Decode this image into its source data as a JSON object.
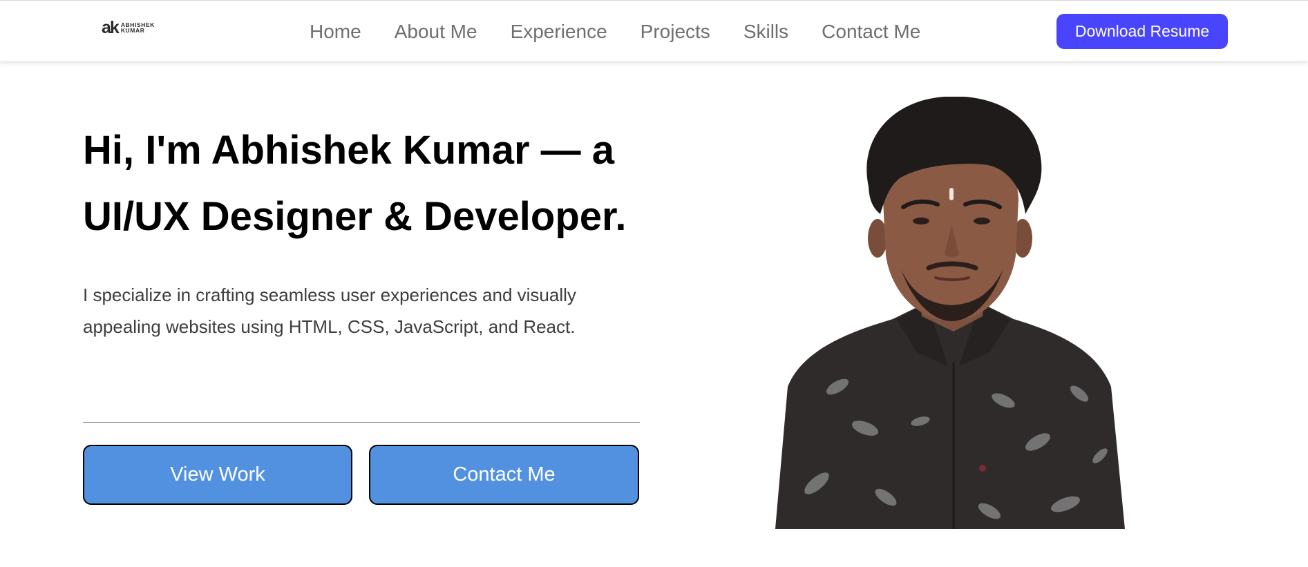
{
  "nav": {
    "logo": {
      "mark": "ak",
      "line1": "ABHISHEK",
      "line2": "KUMAR"
    },
    "links": [
      {
        "label": "Home"
      },
      {
        "label": "About Me"
      },
      {
        "label": "Experience"
      },
      {
        "label": "Projects"
      },
      {
        "label": "Skills"
      },
      {
        "label": "Contact Me"
      }
    ],
    "resume_button": "Download Resume"
  },
  "hero": {
    "title": "Hi, I'm Abhishek Kumar — a UI/UX Designer & Developer.",
    "description": "I specialize in crafting seamless user experiences and visually appealing websites using HTML, CSS, JavaScript, and React.",
    "buttons": {
      "view_work": "View Work",
      "contact": "Contact Me"
    }
  },
  "colors": {
    "accent": "#4945ff",
    "button_blue": "#5291e0",
    "nav_text": "#6e6e6e"
  }
}
